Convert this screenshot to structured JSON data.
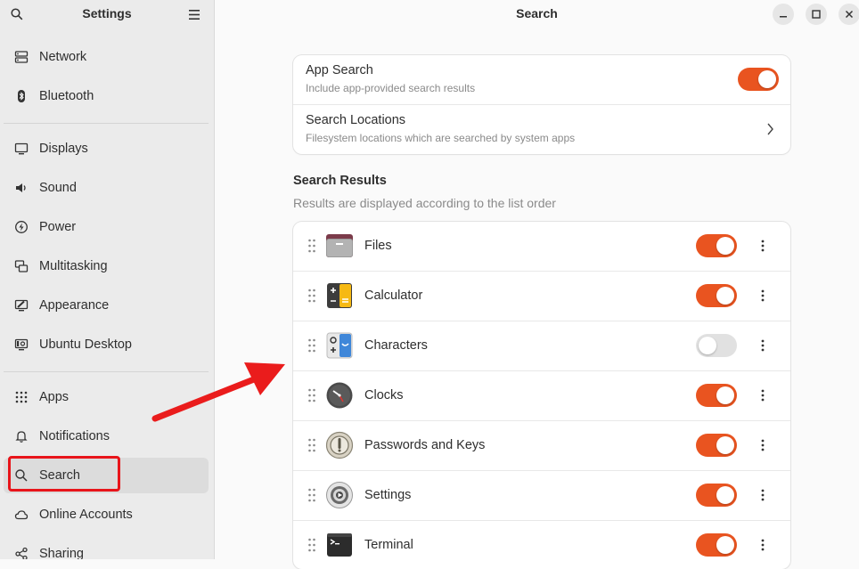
{
  "sidebar": {
    "title": "Settings",
    "groups": [
      [
        {
          "label": "Network",
          "icon": "network-icon"
        },
        {
          "label": "Bluetooth",
          "icon": "bluetooth-icon"
        }
      ],
      [
        {
          "label": "Displays",
          "icon": "display-icon"
        },
        {
          "label": "Sound",
          "icon": "sound-icon"
        },
        {
          "label": "Power",
          "icon": "power-icon"
        },
        {
          "label": "Multitasking",
          "icon": "multitasking-icon"
        },
        {
          "label": "Appearance",
          "icon": "appearance-icon"
        },
        {
          "label": "Ubuntu Desktop",
          "icon": "ubuntu-desktop-icon"
        }
      ],
      [
        {
          "label": "Apps",
          "icon": "apps-grid-icon"
        },
        {
          "label": "Notifications",
          "icon": "bell-icon"
        },
        {
          "label": "Search",
          "icon": "search-icon",
          "active": true
        },
        {
          "label": "Online Accounts",
          "icon": "cloud-icon"
        },
        {
          "label": "Sharing",
          "icon": "share-icon"
        }
      ]
    ]
  },
  "main": {
    "title": "Search",
    "top_card": [
      {
        "title": "App Search",
        "subtitle": "Include app-provided search results",
        "control": "toggle",
        "on": true
      },
      {
        "title": "Search Locations",
        "subtitle": "Filesystem locations which are searched by system apps",
        "control": "chevron"
      }
    ],
    "results_title": "Search Results",
    "results_subtitle": "Results are displayed according to the list order",
    "apps": [
      {
        "name": "Files",
        "icon": "files-icon",
        "on": true
      },
      {
        "name": "Calculator",
        "icon": "calculator-icon",
        "on": true
      },
      {
        "name": "Characters",
        "icon": "characters-icon",
        "on": false
      },
      {
        "name": "Clocks",
        "icon": "clocks-icon",
        "on": true
      },
      {
        "name": "Passwords and Keys",
        "icon": "passwords-keys-icon",
        "on": true
      },
      {
        "name": "Settings",
        "icon": "settings-gear-icon",
        "on": true
      },
      {
        "name": "Terminal",
        "icon": "terminal-icon",
        "on": true
      }
    ]
  },
  "colors": {
    "accent": "#e95420",
    "annotation": "#e8141a"
  }
}
